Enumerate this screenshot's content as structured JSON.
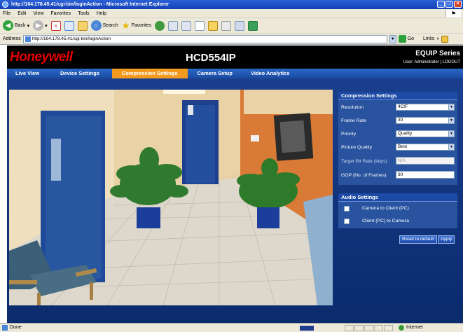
{
  "window": {
    "title": "http://164.178.45.41/cgi-bin/loginAction - Microsoft Internet Explorer",
    "menu": [
      "File",
      "Edit",
      "View",
      "Favorites",
      "Tools",
      "Help"
    ],
    "toolbar": {
      "back": "Back",
      "search": "Search",
      "favorites": "Favorites"
    },
    "address": {
      "label": "Address",
      "url": "http://164.178.45.41/cgi-bin/loginAction",
      "go": "Go",
      "links": "Links"
    },
    "status": {
      "text": "Done",
      "zone": "Internet"
    }
  },
  "header": {
    "logo": "Honeywell",
    "model": "HCD554IP",
    "series": "EQUIP Series",
    "user_prefix": "User: Administrator | ",
    "logout": "LOGOUT"
  },
  "nav": {
    "tabs": [
      {
        "label": "Live View"
      },
      {
        "label": "Device Settings"
      },
      {
        "label": "Compression Settings"
      },
      {
        "label": "Camera Setup"
      },
      {
        "label": "Video Analytics"
      }
    ],
    "active": "Compression Settings"
  },
  "compression": {
    "title": "Compression Settings",
    "resolution": {
      "label": "Resolution",
      "value": "4CIF"
    },
    "frame_rate": {
      "label": "Frame Rate",
      "value": "30"
    },
    "priority": {
      "label": "Priority",
      "value": "Quality"
    },
    "picture_quality": {
      "label": "Picture Quality",
      "value": "Best"
    },
    "target_bit_rate": {
      "label": "Target Bit Rate (kbps)",
      "value": "N/A"
    },
    "gop": {
      "label": "GOP (No. of Frames)",
      "value": "30"
    }
  },
  "audio": {
    "title": "Audio Settings",
    "camera_to_client": {
      "label": "Camera to Client (PC)",
      "checked": false
    },
    "client_to_camera": {
      "label": "Client (PC) to Camera",
      "checked": false
    }
  },
  "buttons": {
    "reset": "Reset to default",
    "apply": "Apply"
  },
  "colors": {
    "brand_red": "#e30000",
    "nav_active": "#f29a1f",
    "nav_bg": "#1a4aa0",
    "panel_bg": "#29539f"
  }
}
